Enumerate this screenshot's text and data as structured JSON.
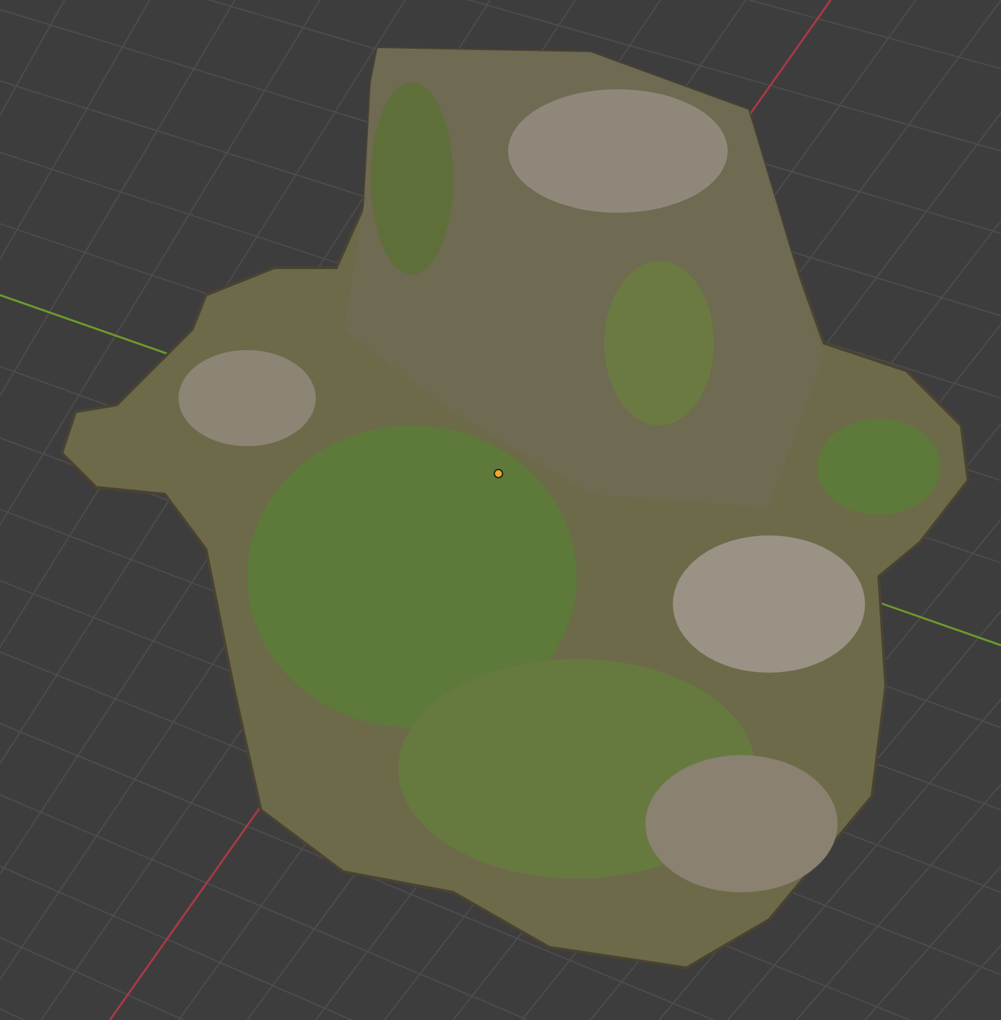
{
  "viewport": {
    "grid": true,
    "axes": true,
    "origin_point": true
  }
}
